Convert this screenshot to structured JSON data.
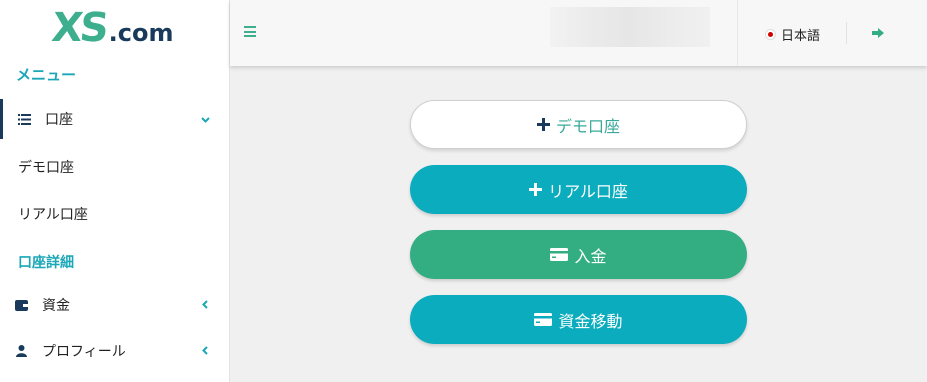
{
  "brand": {
    "logo_main": "XS",
    "logo_suffix": ".com"
  },
  "sidebar": {
    "menu_heading": "メニュー",
    "items": [
      {
        "label": "口座",
        "icon": "list-icon",
        "chevron": "down"
      },
      {
        "label": "デモ口座"
      },
      {
        "label": "リアル口座"
      },
      {
        "label": "口座詳細"
      },
      {
        "label": "資金",
        "icon": "wallet-icon",
        "chevron": "left"
      },
      {
        "label": "プロフィール",
        "icon": "user-icon",
        "chevron": "left"
      }
    ]
  },
  "topbar": {
    "menu_icon": "hamburger-icon",
    "language": "日本語",
    "language_flag": "japan-flag-icon",
    "logout_icon": "sign-out-icon"
  },
  "actions": {
    "demo": "デモ口座",
    "real": "リアル口座",
    "deposit": "入金",
    "transfer": "資金移動"
  },
  "colors": {
    "accent_teal": "#0bacbd",
    "accent_green": "#33ae83",
    "brand_green": "#3dae8e",
    "navy": "#1a3a5c"
  }
}
